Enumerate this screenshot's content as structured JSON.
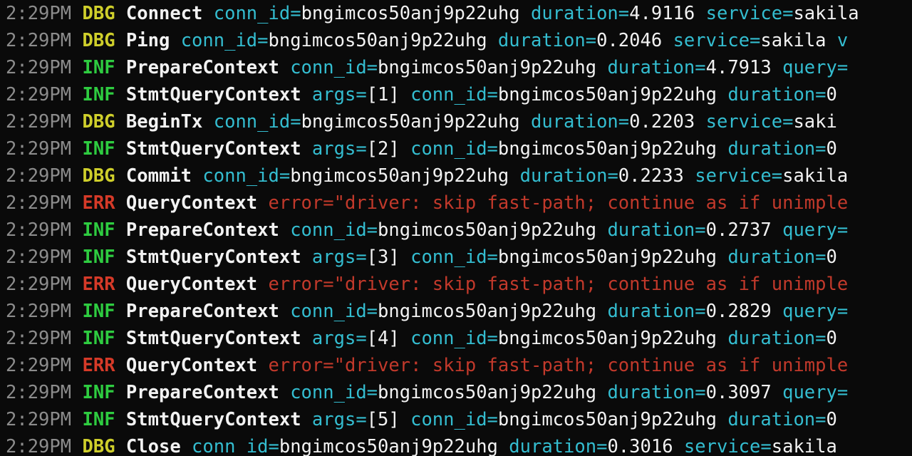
{
  "terminal": {
    "background_color": "#0a0a0a",
    "colors": {
      "timestamp": "#8c8c8c",
      "level_debug": "#cfcf2b",
      "level_info": "#2ecc40",
      "level_error": "#d63a28",
      "message": "#f2f2f2",
      "key": "#34bdd0",
      "value": "#f2f2f2",
      "error_text": "#c2392b"
    },
    "lines": [
      {
        "timestamp": "2:29PM",
        "level": "DBG",
        "message": "Connect",
        "fields": [
          {
            "key": "conn_id=",
            "value": "bngimcos50anj9p22uhg"
          },
          {
            "key": "duration=",
            "value": "4.9116"
          },
          {
            "key": "service=",
            "value": "sakila"
          }
        ]
      },
      {
        "timestamp": "2:29PM",
        "level": "DBG",
        "message": "Ping",
        "fields": [
          {
            "key": "conn_id=",
            "value": "bngimcos50anj9p22uhg"
          },
          {
            "key": "duration=",
            "value": "0.2046"
          },
          {
            "key": "service=",
            "value": "sakila"
          },
          {
            "key": "v",
            "value": ""
          }
        ]
      },
      {
        "timestamp": "2:29PM",
        "level": "INF",
        "message": "PrepareContext",
        "fields": [
          {
            "key": "conn_id=",
            "value": "bngimcos50anj9p22uhg"
          },
          {
            "key": "duration=",
            "value": "4.7913"
          },
          {
            "key": "query=",
            "value": ""
          }
        ]
      },
      {
        "timestamp": "2:29PM",
        "level": "INF",
        "message": "StmtQueryContext",
        "fields": [
          {
            "key": "args=",
            "value": "[1]"
          },
          {
            "key": "conn_id=",
            "value": "bngimcos50anj9p22uhg"
          },
          {
            "key": "duration=",
            "value": "0"
          }
        ]
      },
      {
        "timestamp": "2:29PM",
        "level": "DBG",
        "message": "BeginTx",
        "fields": [
          {
            "key": "conn_id=",
            "value": "bngimcos50anj9p22uhg"
          },
          {
            "key": "duration=",
            "value": "0.2203"
          },
          {
            "key": "service=",
            "value": "saki"
          }
        ]
      },
      {
        "timestamp": "2:29PM",
        "level": "INF",
        "message": "StmtQueryContext",
        "fields": [
          {
            "key": "args=",
            "value": "[2]"
          },
          {
            "key": "conn_id=",
            "value": "bngimcos50anj9p22uhg"
          },
          {
            "key": "duration=",
            "value": "0"
          }
        ]
      },
      {
        "timestamp": "2:29PM",
        "level": "DBG",
        "message": "Commit",
        "fields": [
          {
            "key": "conn_id=",
            "value": "bngimcos50anj9p22uhg"
          },
          {
            "key": "duration=",
            "value": "0.2233"
          },
          {
            "key": "service=",
            "value": "sakila"
          }
        ]
      },
      {
        "timestamp": "2:29PM",
        "level": "ERR",
        "message": "QueryContext",
        "error_field": {
          "key": "error=",
          "value": "\"driver: skip fast-path; continue as if unimple"
        }
      },
      {
        "timestamp": "2:29PM",
        "level": "INF",
        "message": "PrepareContext",
        "fields": [
          {
            "key": "conn_id=",
            "value": "bngimcos50anj9p22uhg"
          },
          {
            "key": "duration=",
            "value": "0.2737"
          },
          {
            "key": "query=",
            "value": ""
          }
        ]
      },
      {
        "timestamp": "2:29PM",
        "level": "INF",
        "message": "StmtQueryContext",
        "fields": [
          {
            "key": "args=",
            "value": "[3]"
          },
          {
            "key": "conn_id=",
            "value": "bngimcos50anj9p22uhg"
          },
          {
            "key": "duration=",
            "value": "0"
          }
        ]
      },
      {
        "timestamp": "2:29PM",
        "level": "ERR",
        "message": "QueryContext",
        "error_field": {
          "key": "error=",
          "value": "\"driver: skip fast-path; continue as if unimple"
        }
      },
      {
        "timestamp": "2:29PM",
        "level": "INF",
        "message": "PrepareContext",
        "fields": [
          {
            "key": "conn_id=",
            "value": "bngimcos50anj9p22uhg"
          },
          {
            "key": "duration=",
            "value": "0.2829"
          },
          {
            "key": "query=",
            "value": ""
          }
        ]
      },
      {
        "timestamp": "2:29PM",
        "level": "INF",
        "message": "StmtQueryContext",
        "fields": [
          {
            "key": "args=",
            "value": "[4]"
          },
          {
            "key": "conn_id=",
            "value": "bngimcos50anj9p22uhg"
          },
          {
            "key": "duration=",
            "value": "0"
          }
        ]
      },
      {
        "timestamp": "2:29PM",
        "level": "ERR",
        "message": "QueryContext",
        "error_field": {
          "key": "error=",
          "value": "\"driver: skip fast-path; continue as if unimple"
        }
      },
      {
        "timestamp": "2:29PM",
        "level": "INF",
        "message": "PrepareContext",
        "fields": [
          {
            "key": "conn_id=",
            "value": "bngimcos50anj9p22uhg"
          },
          {
            "key": "duration=",
            "value": "0.3097"
          },
          {
            "key": "query=",
            "value": ""
          }
        ]
      },
      {
        "timestamp": "2:29PM",
        "level": "INF",
        "message": "StmtQueryContext",
        "fields": [
          {
            "key": "args=",
            "value": "[5]"
          },
          {
            "key": "conn_id=",
            "value": "bngimcos50anj9p22uhg"
          },
          {
            "key": "duration=",
            "value": "0"
          }
        ]
      },
      {
        "timestamp": "2:29PM",
        "level": "DBG",
        "message": "Close",
        "fields": [
          {
            "key": "conn_id=",
            "value": "bngimcos50anj9p22uhg"
          },
          {
            "key": "duration=",
            "value": "0.3016"
          },
          {
            "key": "service=",
            "value": "sakila"
          }
        ]
      }
    ]
  }
}
